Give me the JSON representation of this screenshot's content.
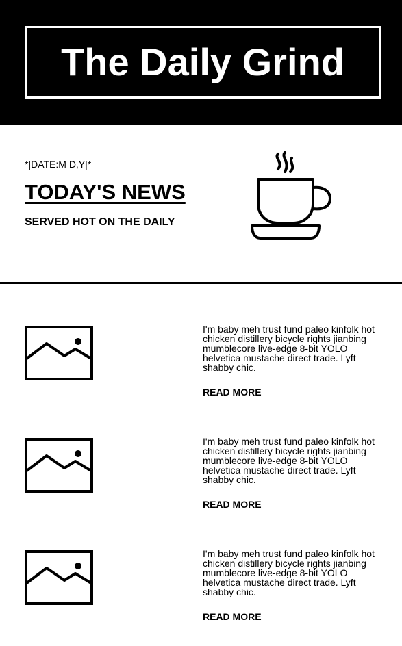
{
  "header": {
    "title": "The Daily Grind"
  },
  "hero": {
    "date": "*|DATE:M D,Y|*",
    "headline": "TODAY'S NEWS",
    "tagline": "SERVED HOT ON THE DAILY",
    "icon": "coffee-cup-icon"
  },
  "articles": [
    {
      "icon": "image-placeholder-icon",
      "text": "I'm baby meh trust fund paleo kinfolk hot chicken distillery bicycle rights jianbing mumblecore live-edge 8-bit YOLO helvetica mustache direct trade. Lyft shabby chic.",
      "link": "READ MORE"
    },
    {
      "icon": "image-placeholder-icon",
      "text": "I'm baby meh trust fund paleo kinfolk hot chicken distillery bicycle rights jianbing mumblecore live-edge 8-bit YOLO helvetica mustache direct trade. Lyft shabby chic.",
      "link": "READ MORE"
    },
    {
      "icon": "image-placeholder-icon",
      "text": "I'm baby meh trust fund paleo kinfolk hot chicken distillery bicycle rights jianbing mumblecore live-edge 8-bit YOLO helvetica mustache direct trade. Lyft shabby chic.",
      "link": "READ MORE"
    }
  ],
  "colors": {
    "background": "#ffffff",
    "ink": "#000000"
  }
}
